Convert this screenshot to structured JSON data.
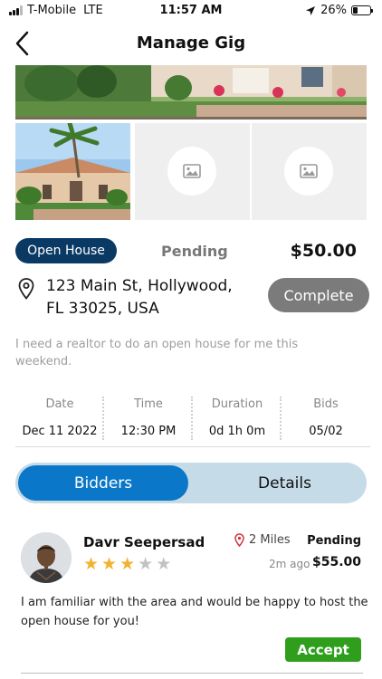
{
  "status_bar": {
    "carrier": "T-Mobile",
    "network": "LTE",
    "time": "11:57 AM",
    "battery": "26%",
    "battery_level": 0.26
  },
  "nav": {
    "title": "Manage Gig",
    "back_icon": "chevron-left-icon"
  },
  "gig": {
    "type_badge": "Open House",
    "status": "Pending",
    "price": "$50.00",
    "address_line1": "123 Main St, Hollywood,",
    "address_line2": "FL 33025, USA",
    "complete_button": "Complete",
    "description": "I need a realtor to do an open house for me this weekend.",
    "stats": [
      {
        "label": "Date",
        "value": "Dec 11 2022"
      },
      {
        "label": "Time",
        "value": "12:30 PM"
      },
      {
        "label": "Duration",
        "value": "0d 1h 0m"
      },
      {
        "label": "Bids",
        "value": "05/02"
      }
    ]
  },
  "tabs": {
    "bidders": "Bidders",
    "details": "Details"
  },
  "bidder": {
    "name": "Davr Seepersad",
    "rating": 3,
    "rating_max": 5,
    "distance": "2 Miles",
    "status": "Pending",
    "time_ago": "2m ago",
    "price": "$55.00",
    "message": "I am familiar with the area and would be happy to host the open house for you!",
    "accept_button": "Accept"
  },
  "colors": {
    "badge_bg": "#0a3a64",
    "tab_active": "#0a77c9",
    "tab_track": "#c5dbe8",
    "complete_bg": "#7b7b7b",
    "accept_bg": "#2e9e1c",
    "star_on": "#f2b230",
    "star_off": "#c2c2c2"
  }
}
